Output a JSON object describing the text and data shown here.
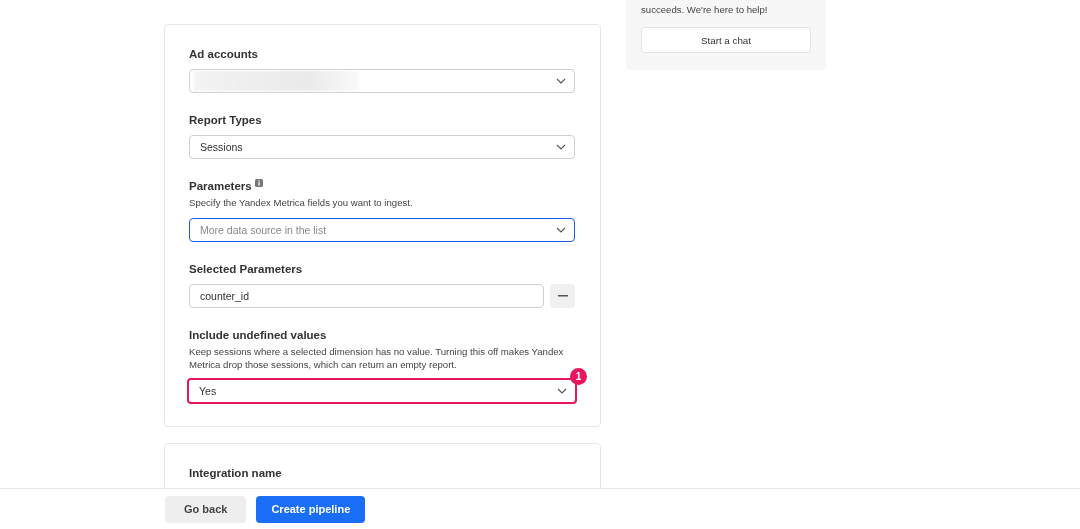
{
  "form_fields": [
    {
      "kind": "select",
      "label": "Ad accounts",
      "blurred": true,
      "focused": false,
      "flagged": false
    },
    {
      "kind": "select",
      "label": "Report Types",
      "value": "Sessions",
      "focused": false,
      "flagged": false
    },
    {
      "kind": "select",
      "label": "Parameters",
      "info": true,
      "description": "Specify the Yandex Metrica fields you want to ingest.",
      "placeholder": "More data source in the list",
      "focused": true,
      "flagged": false
    },
    {
      "kind": "input",
      "label": "Selected Parameters",
      "value": "counter_id",
      "removable": true
    },
    {
      "kind": "select",
      "label": "Include undefined values",
      "description": "Keep sessions where a selected dimension has no value. Turning this off makes Yandex Metrica drop those sessions, which can return an empty report.",
      "value": "Yes",
      "focused": false,
      "flagged": true,
      "marker": "1"
    }
  ],
  "second_card": {
    "label": "Integration name"
  },
  "help_panel": {
    "text": "succeeds. We're here to help!",
    "button": "Start a chat"
  },
  "footer": {
    "back_button": "Go back",
    "primary_button": "Create pipeline"
  }
}
